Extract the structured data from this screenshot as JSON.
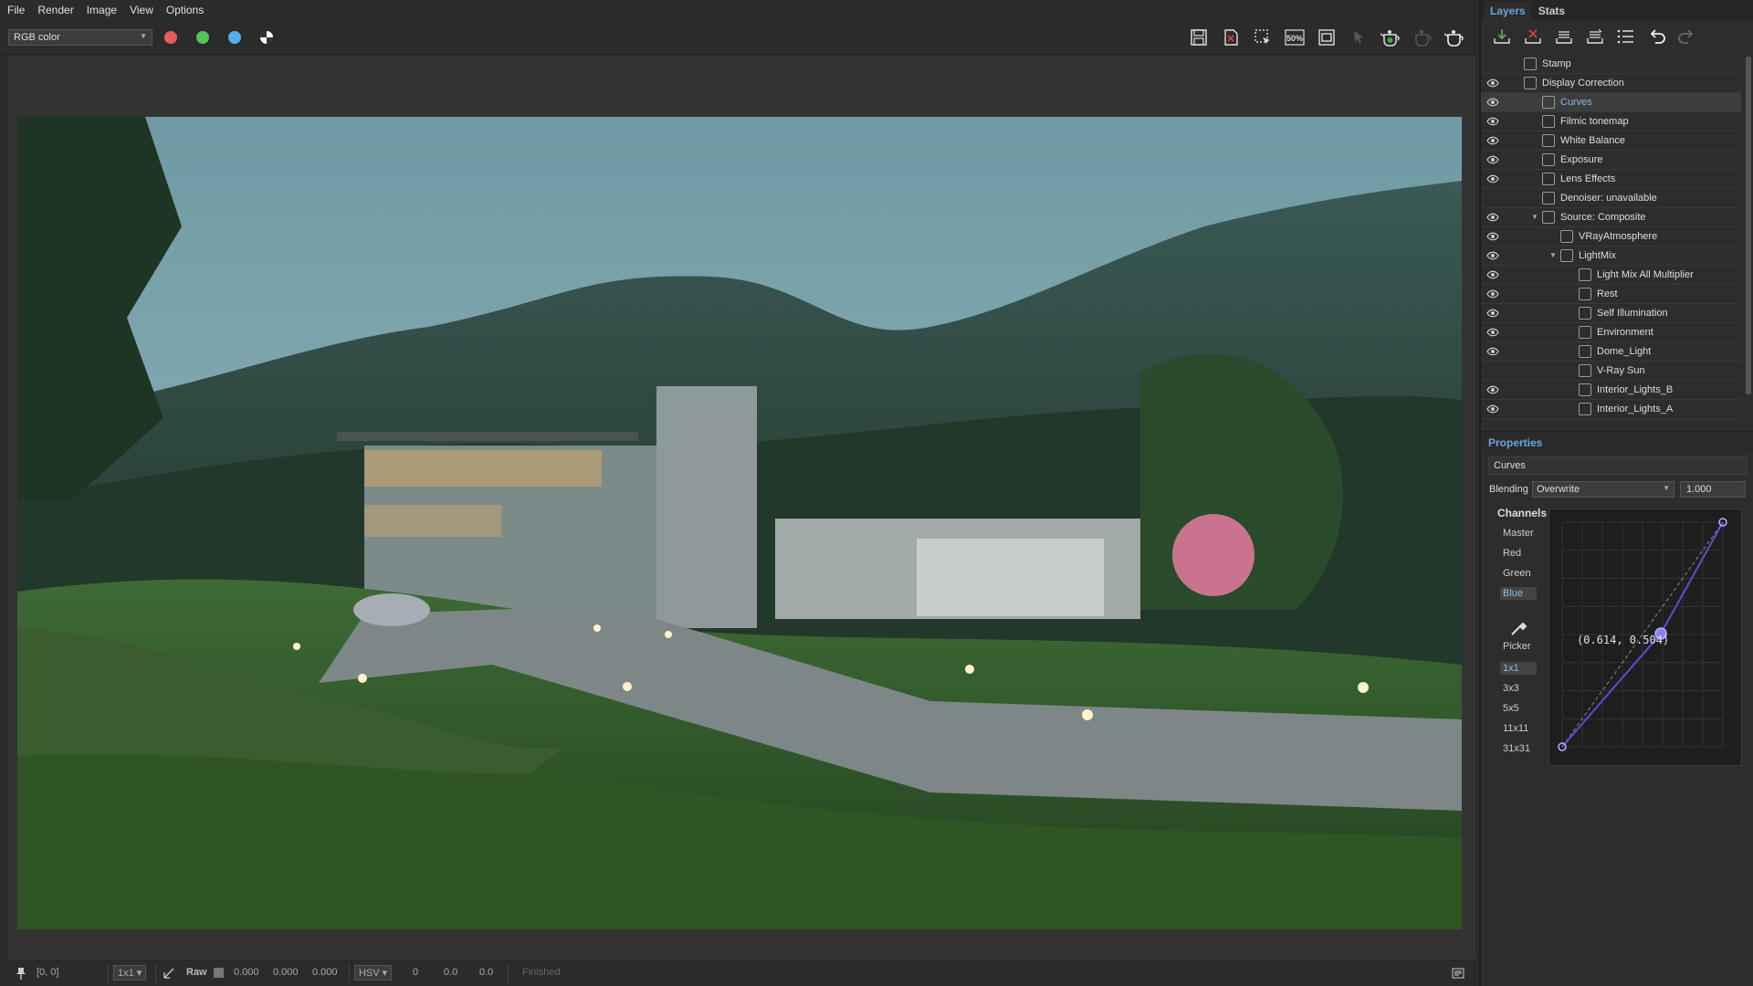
{
  "menu": [
    "File",
    "Render",
    "Image",
    "View",
    "Options"
  ],
  "toolbar": {
    "channel_select": "RGB color",
    "channel_colors": [
      "#e65b5b",
      "#54c454",
      "#4fb1e8"
    ],
    "icons": [
      "save-icon",
      "clear-icon",
      "region-select-icon",
      "zoom-50-icon",
      "fit-icon",
      "cursor-icon",
      "render-teapot-icon",
      "render-teapot-disabled-icon",
      "interactive-teapot-icon"
    ],
    "zoom_label": "50%"
  },
  "status_bar": {
    "coords": "[0, 0]",
    "sample_size": "1x1",
    "mode": "Raw",
    "rgb": [
      "0.000",
      "0.000",
      "0.000"
    ],
    "color_space": "HSV",
    "hsv": [
      "0",
      "0.0",
      "0.0"
    ],
    "status": "Finished"
  },
  "panel": {
    "tabs": [
      "Layers",
      "Stats"
    ],
    "layers": [
      {
        "label": "Stamp",
        "indent": 0,
        "eye": false,
        "icon": "stamp-icon"
      },
      {
        "label": "Display Correction",
        "indent": 0,
        "eye": true,
        "icon": "display-correction-icon"
      },
      {
        "label": "Curves",
        "indent": 1,
        "eye": true,
        "icon": "curves-icon",
        "selected": true
      },
      {
        "label": "Filmic tonemap",
        "indent": 1,
        "eye": true,
        "icon": "filmic-icon"
      },
      {
        "label": "White Balance",
        "indent": 1,
        "eye": true,
        "icon": "white-balance-icon"
      },
      {
        "label": "Exposure",
        "indent": 1,
        "eye": true,
        "icon": "exposure-icon"
      },
      {
        "label": "Lens Effects",
        "indent": 1,
        "eye": true,
        "icon": "lens-effects-icon"
      },
      {
        "label": "Denoiser: unavailable",
        "indent": 1,
        "eye": false,
        "icon": "denoiser-icon"
      },
      {
        "label": "Source: Composite",
        "indent": 1,
        "eye": true,
        "icon": "composite-icon",
        "expanded": true
      },
      {
        "label": "VRayAtmosphere",
        "indent": 2,
        "eye": true,
        "icon": "layer-icon"
      },
      {
        "label": "LightMix",
        "indent": 2,
        "eye": true,
        "icon": "folder-icon",
        "expanded": true
      },
      {
        "label": "Light Mix All Multiplier",
        "indent": 3,
        "eye": true,
        "icon": "multiplier-icon"
      },
      {
        "label": "Rest",
        "indent": 3,
        "eye": true,
        "icon": "layer-icon"
      },
      {
        "label": "Self Illumination",
        "indent": 3,
        "eye": true,
        "icon": "layer-icon"
      },
      {
        "label": "Environment",
        "indent": 3,
        "eye": true,
        "icon": "layer-icon"
      },
      {
        "label": "Dome_Light",
        "indent": 3,
        "eye": true,
        "icon": "layer-icon"
      },
      {
        "label": "V-Ray Sun",
        "indent": 3,
        "eye": false,
        "icon": "layer-icon"
      },
      {
        "label": "Interior_Lights_B",
        "indent": 3,
        "eye": true,
        "icon": "layer-icon"
      },
      {
        "label": "Interior_Lights_A",
        "indent": 3,
        "eye": true,
        "icon": "layer-icon"
      }
    ],
    "properties": {
      "title": "Properties",
      "layer_name": "Curves",
      "blending_label": "Blending",
      "blending_mode": "Overwrite",
      "blending_value": "1.000",
      "channels_title": "Channels",
      "channels": [
        "Master",
        "Red",
        "Green",
        "Blue"
      ],
      "active_channel": "Blue",
      "picker_label": "Picker",
      "sample_sizes": [
        "1x1",
        "3x3",
        "5x5",
        "11x11",
        "31x31"
      ],
      "active_sample": "1x1",
      "curve_point_label": "(0.614, 0.504)",
      "curve_points": [
        [
          0,
          0
        ],
        [
          0.614,
          0.504
        ],
        [
          1,
          1
        ]
      ],
      "curve_color": "#5a4fd6"
    }
  }
}
